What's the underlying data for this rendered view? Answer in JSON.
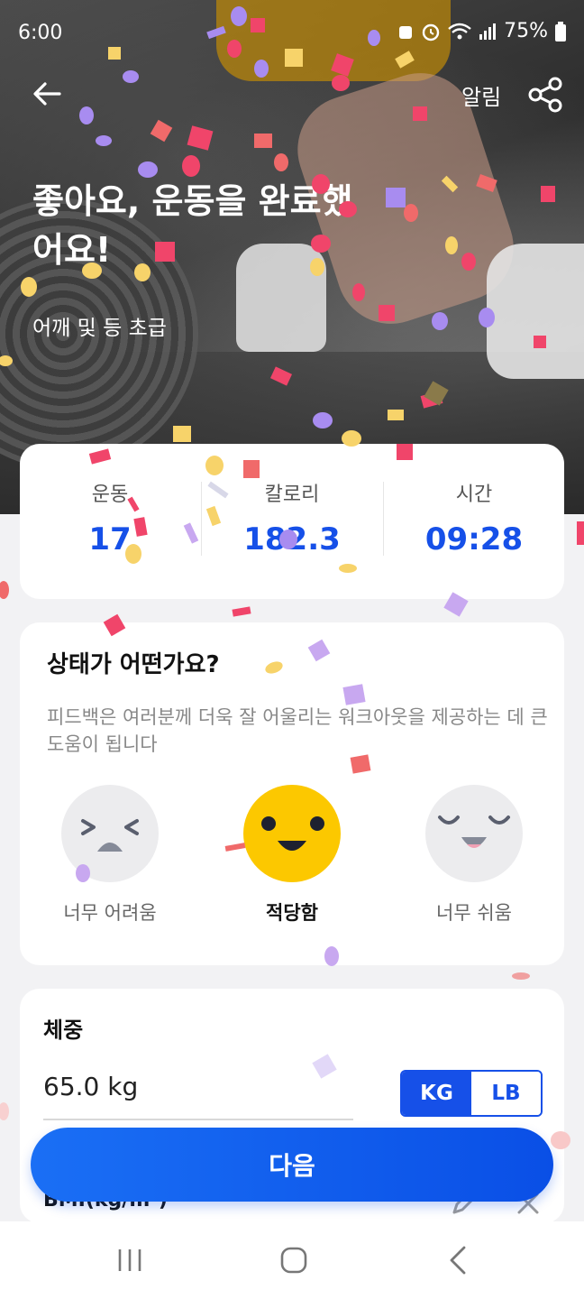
{
  "status_bar": {
    "time": "6:00",
    "battery": "75%"
  },
  "header": {
    "alarm_label": "알림"
  },
  "hero": {
    "headline": "좋아요, 운동을 완료했어요!",
    "workout_name": "어깨 및 등 초급"
  },
  "stats": [
    {
      "label": "운동",
      "value": "17"
    },
    {
      "label": "칼로리",
      "value": "182.3"
    },
    {
      "label": "시간",
      "value": "09:28"
    }
  ],
  "feedback": {
    "title": "상태가 어떤가요?",
    "description": "피드백은 여러분께 더욱 잘 어울리는 워크아웃을 제공하는 데 큰 도움이 됩니다",
    "options": [
      {
        "label": "너무 어려움",
        "selected": false,
        "icon": "hard-face-icon"
      },
      {
        "label": "적당함",
        "selected": true,
        "icon": "just-right-face-icon"
      },
      {
        "label": "너무 쉬움",
        "selected": false,
        "icon": "easy-face-icon"
      }
    ]
  },
  "weight": {
    "title": "체중",
    "value": "65.0 kg",
    "units": [
      "KG",
      "LB"
    ],
    "selected_unit": "KG",
    "bmi_label": "BMI(kg/m²)"
  },
  "next_button": "다음",
  "colors": {
    "accent": "#1650e8",
    "selected_face": "#fcc800",
    "face_gray": "#ececee"
  }
}
